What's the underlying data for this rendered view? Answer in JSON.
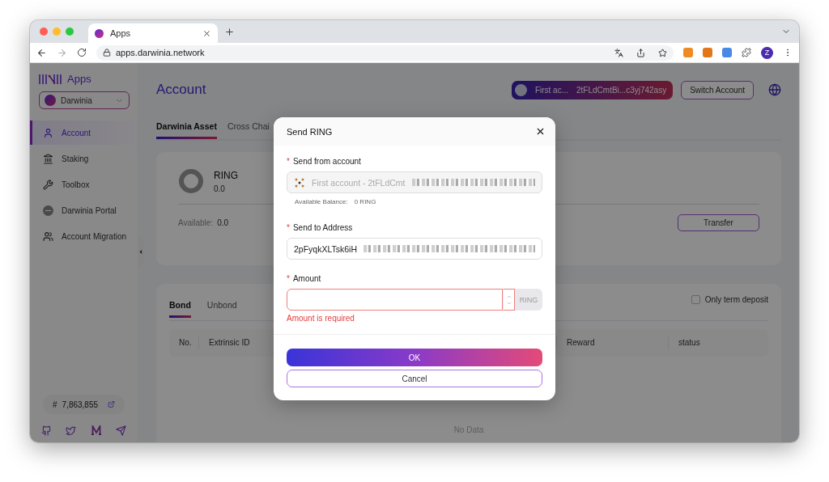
{
  "browser": {
    "tab_title": "Apps",
    "url": "apps.darwinia.network",
    "profile_initial": "Z"
  },
  "sidebar": {
    "brand": "Apps",
    "network": "Darwinia",
    "nav": [
      {
        "label": "Account",
        "selected": true
      },
      {
        "label": "Staking",
        "selected": false
      },
      {
        "label": "Toolbox",
        "selected": false
      },
      {
        "label": "Darwinia Portal",
        "selected": false
      },
      {
        "label": "Account Migration",
        "selected": false
      }
    ],
    "block_number": "7,863,855",
    "block_prefix": "#"
  },
  "header": {
    "title": "Account",
    "account_name": "First ac...",
    "account_address": "2tFLdCmtBi...c3yj742asy",
    "switch_button": "Switch Account"
  },
  "asset_tabs": [
    {
      "label": "Darwinia Asset",
      "selected": true
    },
    {
      "label": "Cross Chai",
      "selected": false
    }
  ],
  "asset": {
    "token": "RING",
    "balance": "0.0",
    "available_label": "Available:",
    "available_value": "0.0",
    "transfer_button": "Transfer"
  },
  "staking": {
    "tabs": [
      {
        "label": "Bond",
        "selected": true
      },
      {
        "label": "Unbond",
        "selected": false
      }
    ],
    "only_term_deposit": {
      "label": "Only term deposit",
      "checked": false
    },
    "columns": [
      "No.",
      "Extrinsic ID",
      "Reward",
      "status"
    ],
    "empty": "No Data"
  },
  "dialog": {
    "title": "Send RING",
    "required_mark": "*",
    "from": {
      "label": "Send from account",
      "value": "First account - 2tFLdCmt",
      "hint_label": "Available Balance:",
      "hint_value": "0 RING"
    },
    "to": {
      "label": "Send to Address",
      "value": "2pFyqkXLTsk6iH"
    },
    "amount": {
      "label": "Amount",
      "unit": "RING",
      "error": "Amount is required"
    },
    "ok_button": "OK",
    "cancel_button": "Cancel"
  }
}
